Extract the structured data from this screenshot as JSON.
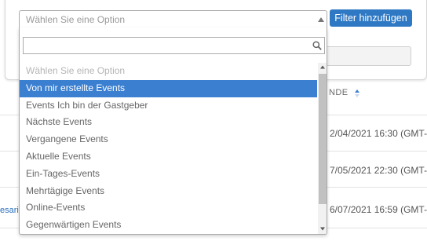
{
  "filter": {
    "add_button": "Filter hinzufügen"
  },
  "select": {
    "current_value": "Wählen Sie eine Option",
    "search_value": "",
    "options": [
      {
        "label": "Wählen Sie eine Option",
        "state": "placeholder"
      },
      {
        "label": "Von mir erstellte Events",
        "state": "selected"
      },
      {
        "label": "Events Ich bin der Gastgeber",
        "state": "normal"
      },
      {
        "label": "Nächste Events",
        "state": "normal"
      },
      {
        "label": "Vergangene Events",
        "state": "normal"
      },
      {
        "label": "Aktuelle Events",
        "state": "normal"
      },
      {
        "label": "Ein-Tages-Events",
        "state": "normal"
      },
      {
        "label": "Mehrtägige Events",
        "state": "normal"
      },
      {
        "label": "Online-Events",
        "state": "normal"
      },
      {
        "label": "Gegenwärtigen Events",
        "state": "normal"
      }
    ]
  },
  "table": {
    "column_header": "NDE",
    "rows": [
      {
        "date": "2/04/2021 16:30 (GMT-0"
      },
      {
        "date": "7/05/2021 22:30 (GMT-0"
      },
      {
        "date": "6/07/2021 16:59 (GMT-0"
      }
    ],
    "left_link_fragment": "esaria"
  },
  "colors": {
    "accent": "#2f79c4",
    "selected_option": "#3b7fd0",
    "link": "#2a6fba"
  },
  "icons": {
    "select_arrow": "triangle-up-icon",
    "search": "search-icon",
    "sort": "sort-icon",
    "scroll_up": "arrow-up-icon",
    "scroll_down": "arrow-down-icon"
  }
}
